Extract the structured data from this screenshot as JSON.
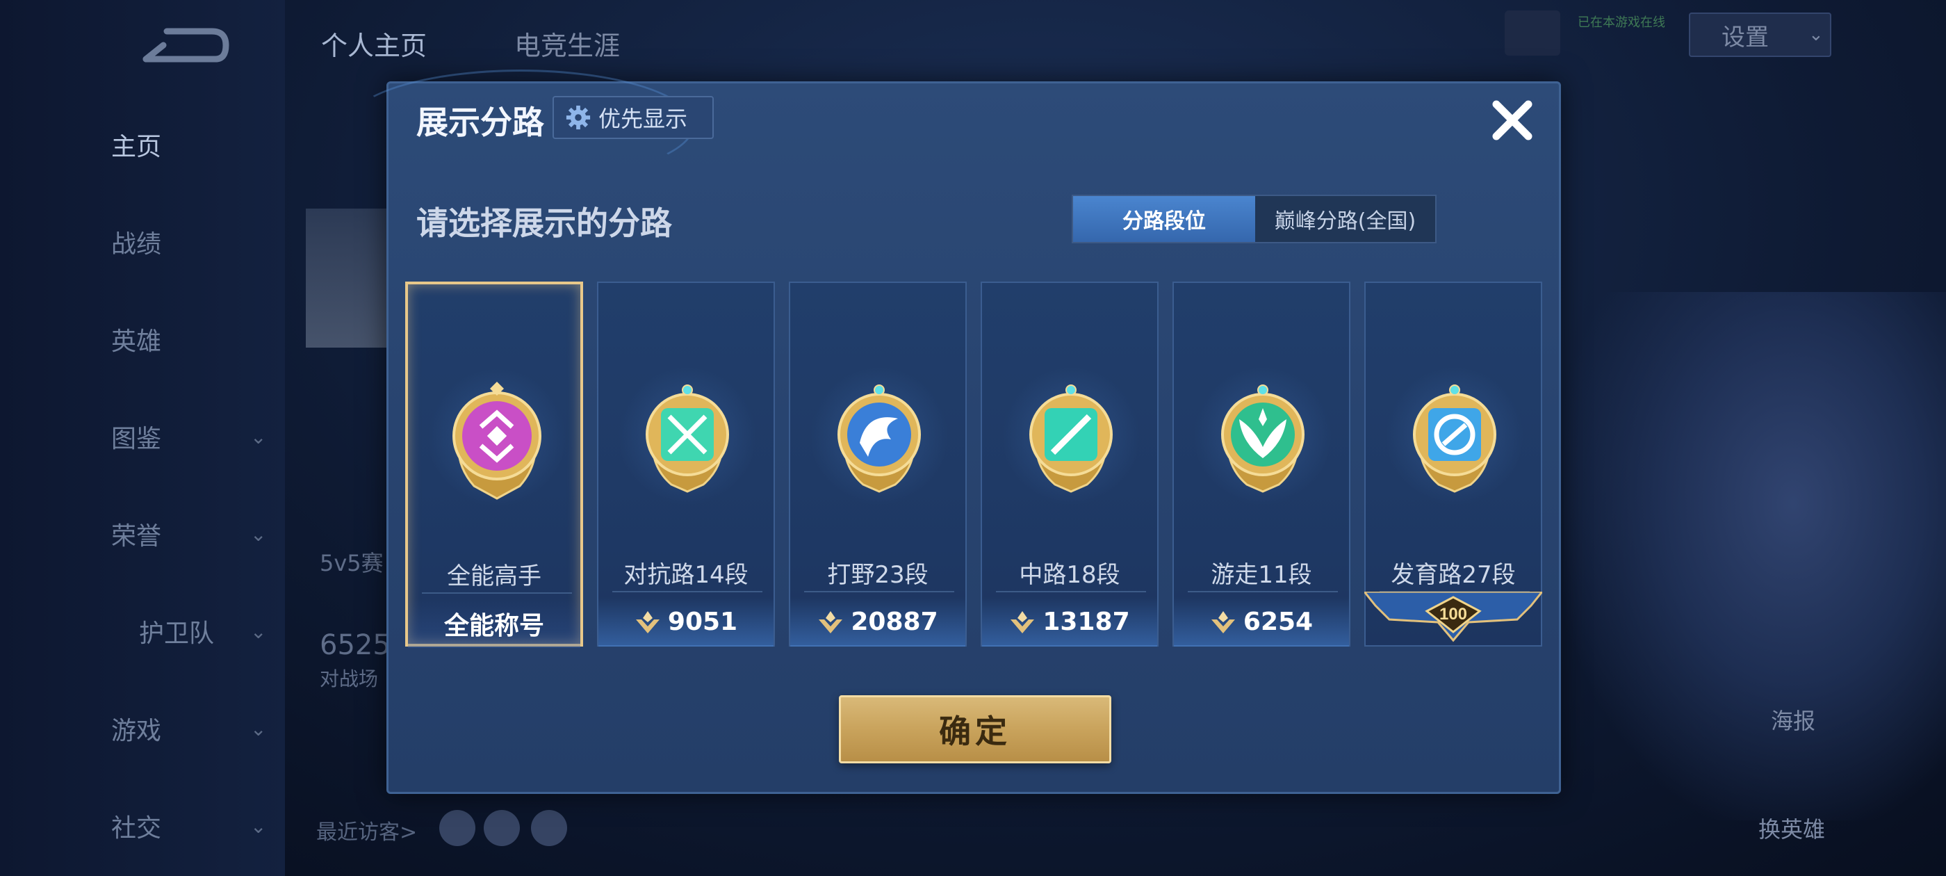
{
  "background": {
    "sidebar": {
      "items": [
        {
          "label": "主页",
          "has_chevron": false
        },
        {
          "label": "战绩",
          "has_chevron": false
        },
        {
          "label": "英雄",
          "has_chevron": false
        },
        {
          "label": "图鉴",
          "has_chevron": true
        },
        {
          "label": "荣誉",
          "has_chevron": true
        },
        {
          "label": "护卫队",
          "has_chevron": true
        },
        {
          "label": "游戏",
          "has_chevron": true
        },
        {
          "label": "社交",
          "has_chevron": true
        }
      ]
    },
    "top_tabs": [
      {
        "label": "个人主页"
      },
      {
        "label": "电竞生涯"
      }
    ],
    "settings_label": "设置",
    "online_note": "已在本游戏在线",
    "left_stats": {
      "mode": "5v5赛",
      "number": "6525",
      "number_caption": "对战场"
    },
    "recent_visitors_label": "最近访客>",
    "right_actions": [
      {
        "label": "海报"
      },
      {
        "label": "换英雄"
      }
    ]
  },
  "modal": {
    "title": "展示分路",
    "priority_label": "优先显示",
    "subtitle": "请选择展示的分路",
    "tabs": [
      {
        "label": "分路段位",
        "active": true
      },
      {
        "label": "巅峰分路(全国)",
        "active": false
      }
    ],
    "cards": [
      {
        "name": "全能高手",
        "bottom": "全能称号",
        "badge_color": "#c94fc6",
        "selected": true,
        "icon": "all-round-badge-icon"
      },
      {
        "name": "对抗路14段",
        "bottom": "9051",
        "badge_color": "#3fd6b0",
        "selected": false,
        "icon": "clash-lane-badge-icon"
      },
      {
        "name": "打野23段",
        "bottom": "20887",
        "badge_color": "#3a7fd8",
        "selected": false,
        "icon": "jungle-badge-icon"
      },
      {
        "name": "中路18段",
        "bottom": "13187",
        "badge_color": "#33d2b5",
        "selected": false,
        "icon": "mid-lane-badge-icon"
      },
      {
        "name": "游走11段",
        "bottom": "6254",
        "badge_color": "#2fbf8e",
        "selected": false,
        "icon": "roam-badge-icon"
      },
      {
        "name": "发育路27段",
        "bottom": "100",
        "badge_color": "#3fa6e8",
        "selected": false,
        "icon": "farm-lane-badge-icon"
      }
    ],
    "confirm_label": "确定"
  }
}
